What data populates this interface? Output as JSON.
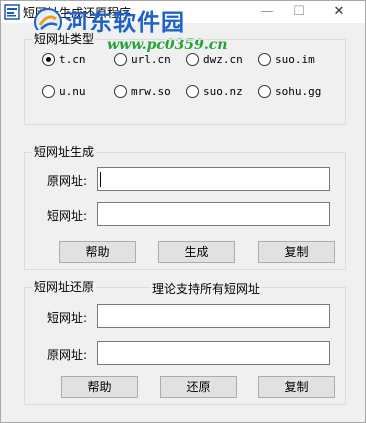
{
  "window": {
    "title": "短网址生成还原程序",
    "min_glyph": "—",
    "max_glyph": "☐",
    "close_glyph": "✕"
  },
  "watermark": {
    "title": "河东软件园",
    "url": "www.pc0359.cn"
  },
  "type_group": {
    "label": "短网址类型",
    "options": [
      {
        "label": "t.cn",
        "checked": true
      },
      {
        "label": "url.cn",
        "checked": false
      },
      {
        "label": "dwz.cn",
        "checked": false
      },
      {
        "label": "suo.im",
        "checked": false
      },
      {
        "label": "u.nu",
        "checked": false
      },
      {
        "label": "mrw.so",
        "checked": false
      },
      {
        "label": "suo.nz",
        "checked": false
      },
      {
        "label": "sohu.gg",
        "checked": false
      }
    ]
  },
  "generate_group": {
    "label": "短网址生成",
    "original_url_label": "原网址:",
    "original_url_value": "",
    "short_url_label": "短网址:",
    "short_url_value": "",
    "help_button": "帮助",
    "generate_button": "生成",
    "copy_button": "复制"
  },
  "restore_group": {
    "label": "短网址还原",
    "note": "理论支持所有短网址",
    "short_url_label": "短网址:",
    "short_url_value": "",
    "original_url_label": "原网址:",
    "original_url_value": "",
    "help_button": "帮助",
    "restore_button": "还原",
    "copy_button": "复制"
  }
}
